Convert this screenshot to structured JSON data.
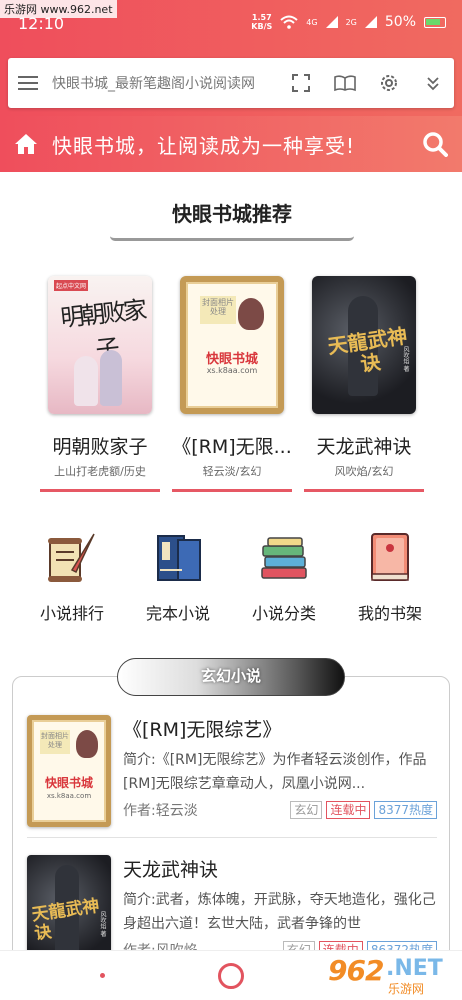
{
  "watermark": "乐游网 www.962.net",
  "status": {
    "time": "12:10",
    "speed_value": "1.57",
    "speed_unit": "KB/S",
    "net1": "4G",
    "net2": "2G",
    "battery": "50%"
  },
  "address": {
    "url": "快眼书城_最新笔趣阁小说阅读网"
  },
  "banner": {
    "slogan": "快眼书城，让阅读成为一种享受!"
  },
  "recommend": {
    "title": "快眼书城推荐",
    "books": [
      {
        "title": "明朝败家子",
        "meta": "上山打老虎额/历史",
        "cover_text": "明朝败家子",
        "cover_brand": "起点中文网"
      },
      {
        "title": "《[RM]无限...",
        "meta": "轻云淡/玄幻",
        "cover_tag": "封面相片处理",
        "cover_name": "快眼书城",
        "cover_url": "xs.k8aa.com"
      },
      {
        "title": "天龙武神诀",
        "meta": "风吹焰/玄幻",
        "cover_text": "天龍武神诀",
        "cover_side": "风吹焰 著"
      }
    ]
  },
  "nav": [
    {
      "label": "小说排行",
      "icon": "scroll-quill-icon"
    },
    {
      "label": "完本小说",
      "icon": "books-icon"
    },
    {
      "label": "小说分类",
      "icon": "stacked-books-icon"
    },
    {
      "label": "我的书架",
      "icon": "bookshelf-icon"
    }
  ],
  "category": {
    "tab": "玄幻小说",
    "items": [
      {
        "title": "《[RM]无限综艺》",
        "desc": "简介:《[RM]无限综艺》为作者轻云淡创作，作品[RM]无限综艺章章动人，凤凰小说网...",
        "author": "作者:轻云淡",
        "badges": [
          "玄幻",
          "连载中",
          "8377热度"
        ],
        "cover_tag": "封面相片处理",
        "cover_name": "快眼书城",
        "cover_url": "xs.k8aa.com"
      },
      {
        "title": "天龙武神诀",
        "desc": "简介:武者，炼体魄，开武脉，夺天地造化，强化己身超出六道！玄世大陆，武者争锋的世",
        "author": "作者:风吹焰",
        "badges": [
          "玄幻",
          "连载中",
          "86372热度"
        ],
        "cover_text": "天龍武神诀",
        "cover_side": "风吹焰 著"
      }
    ]
  },
  "footer_logo": {
    "big": "962",
    "net": ".NET",
    "sub": "乐游网"
  }
}
